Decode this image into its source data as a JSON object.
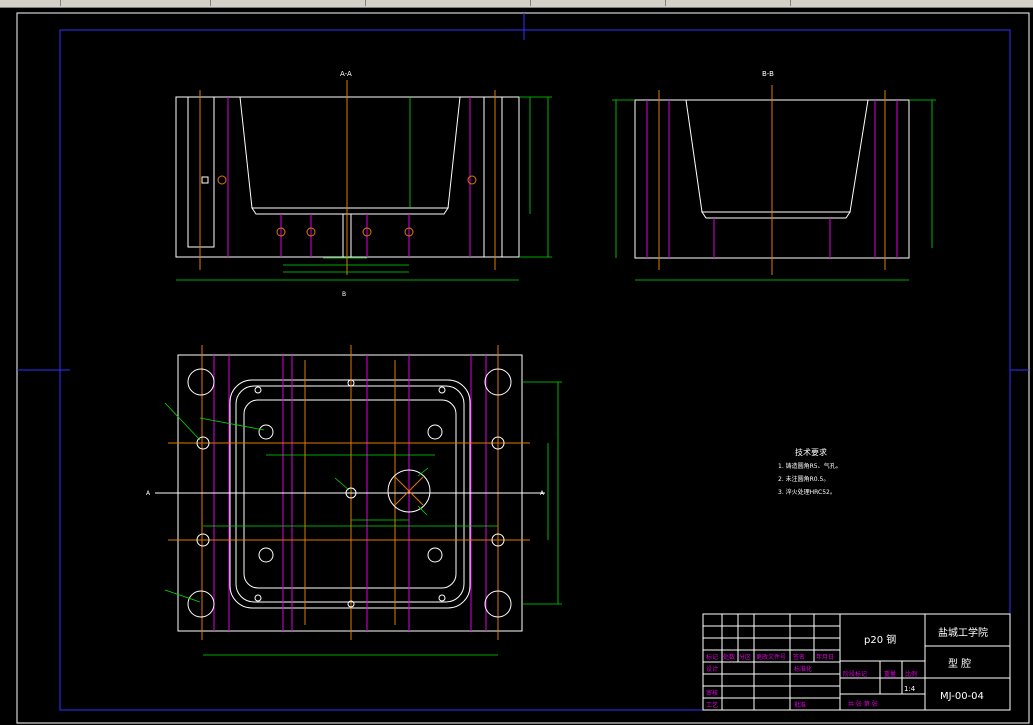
{
  "section_labels": {
    "aa": "A-A",
    "bb": "B-B",
    "a_marker": "A",
    "b_marker": "B"
  },
  "tech_requirements": {
    "title": "技术要求",
    "items": [
      "1. 铸造圆角R5、气孔。",
      "2. 未注圆角R0.5。",
      "3. 淬火处理HRC52。"
    ]
  },
  "title_block": {
    "material": "p20 钢",
    "school": "盐城工学院",
    "part_name": "型 腔",
    "drawing_no": "MJ-00-04",
    "scale": "1:4",
    "header_labels": [
      "标记",
      "处数",
      "分区",
      "更改文件号",
      "签名",
      "年月日"
    ],
    "row_labels": [
      "设计",
      "审核",
      "工艺"
    ],
    "stage_labels": [
      "阶段标记",
      "重量",
      "比例"
    ],
    "bottom_note": "共 张 第 张",
    "approve": "批准",
    "standard": "标准化"
  },
  "colors": {
    "background": "#000000",
    "frame": "#3030ff",
    "outline": "#ffffff",
    "hidden": "#e000e0",
    "center": "#e07a00",
    "dimension": "#00e000"
  }
}
